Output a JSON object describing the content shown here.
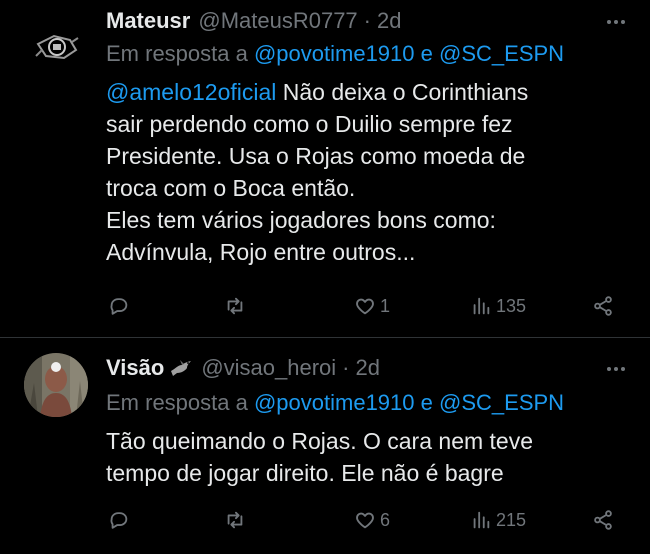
{
  "tweets": [
    {
      "name": "Mateusr",
      "handle": "@MateusR0777",
      "separator": "·",
      "time": "2d",
      "reply_prefix": "Em resposta a",
      "reply_mention1": "@povotime1910",
      "reply_joiner": "e",
      "reply_mention2": "@SC_ESPN",
      "body_mention": "@amelo12oficial",
      "body_text": " Não deixa o Corinthians\nsair perdendo como o Duilio sempre fez\nPresidente. Usa o Rojas como moeda de\ntroca com o Boca então.\nEles tem vários jogadores bons como:\nAdvínvula, Rojo entre outros...",
      "stats": {
        "replies": "",
        "retweets": "",
        "likes": "1",
        "views": "135"
      }
    },
    {
      "name": "Visão",
      "handle": "@visao_heroi",
      "separator": "·",
      "time": "2d",
      "reply_prefix": "Em resposta a",
      "reply_mention1": "@povotime1910",
      "reply_joiner": "e",
      "reply_mention2": "@SC_ESPN",
      "body_text": "Tão queimando o Rojas. O cara nem teve\ntempo de jogar direito. Ele não é bagre",
      "stats": {
        "replies": "",
        "retweets": "",
        "likes": "6",
        "views": "215"
      }
    }
  ],
  "icons": {
    "reply": "speech-bubble-icon",
    "retweet": "retweet-icon",
    "like": "heart-icon",
    "views": "bar-chart-icon",
    "share": "share-icon",
    "more": "more-icon"
  },
  "colors": {
    "background": "#000000",
    "text": "#e7e9ea",
    "muted": "#71767b",
    "link": "#1d9bf0",
    "divider": "#2f3336"
  }
}
